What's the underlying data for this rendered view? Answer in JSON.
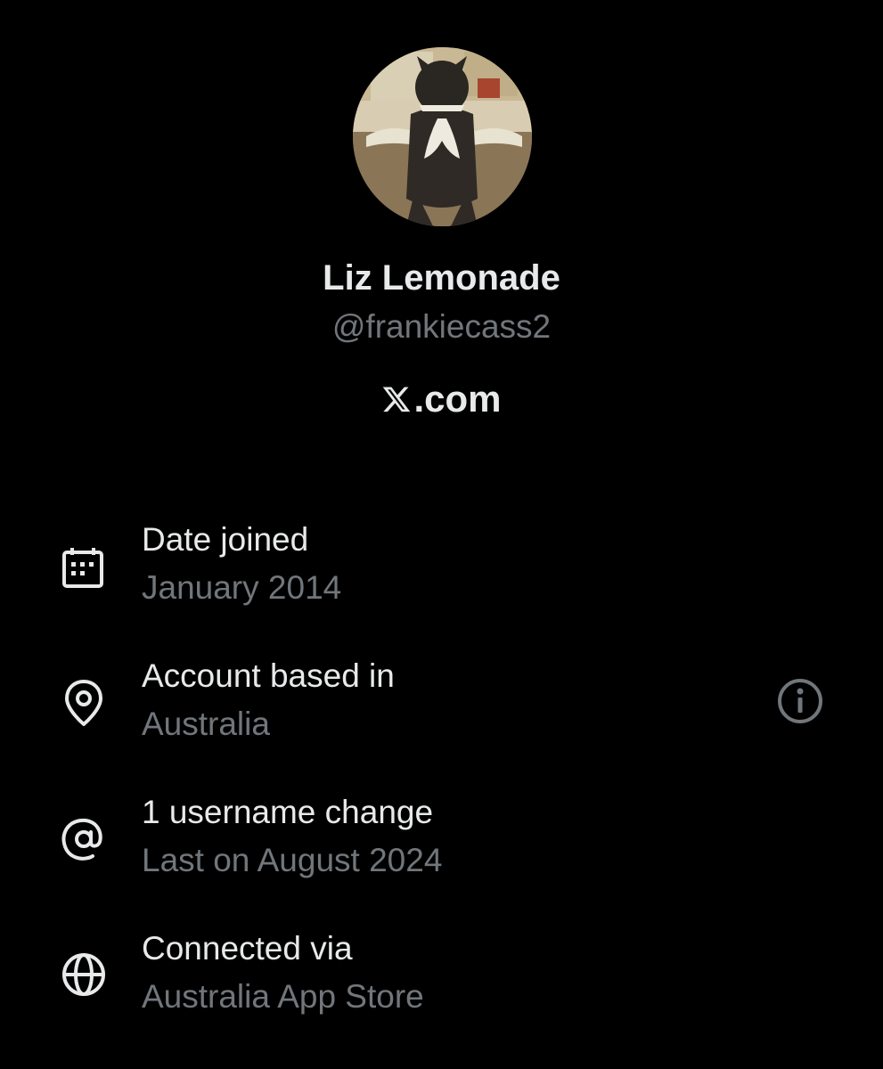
{
  "profile": {
    "display_name": "Liz Lemonade",
    "handle": "@frankiecass2",
    "site": ".com"
  },
  "rows": [
    {
      "title": "Date joined",
      "subtitle": "January 2014",
      "icon": "calendar-icon"
    },
    {
      "title": "Account based in",
      "subtitle": "Australia",
      "icon": "location-pin-icon"
    },
    {
      "title": "1 username change",
      "subtitle": "Last on August 2024",
      "icon": "at-sign-icon"
    },
    {
      "title": "Connected via",
      "subtitle": "Australia App Store",
      "icon": "globe-icon"
    }
  ],
  "colors": {
    "background": "#000000",
    "primary_text": "#e7e9ea",
    "secondary_text": "#71767b"
  }
}
